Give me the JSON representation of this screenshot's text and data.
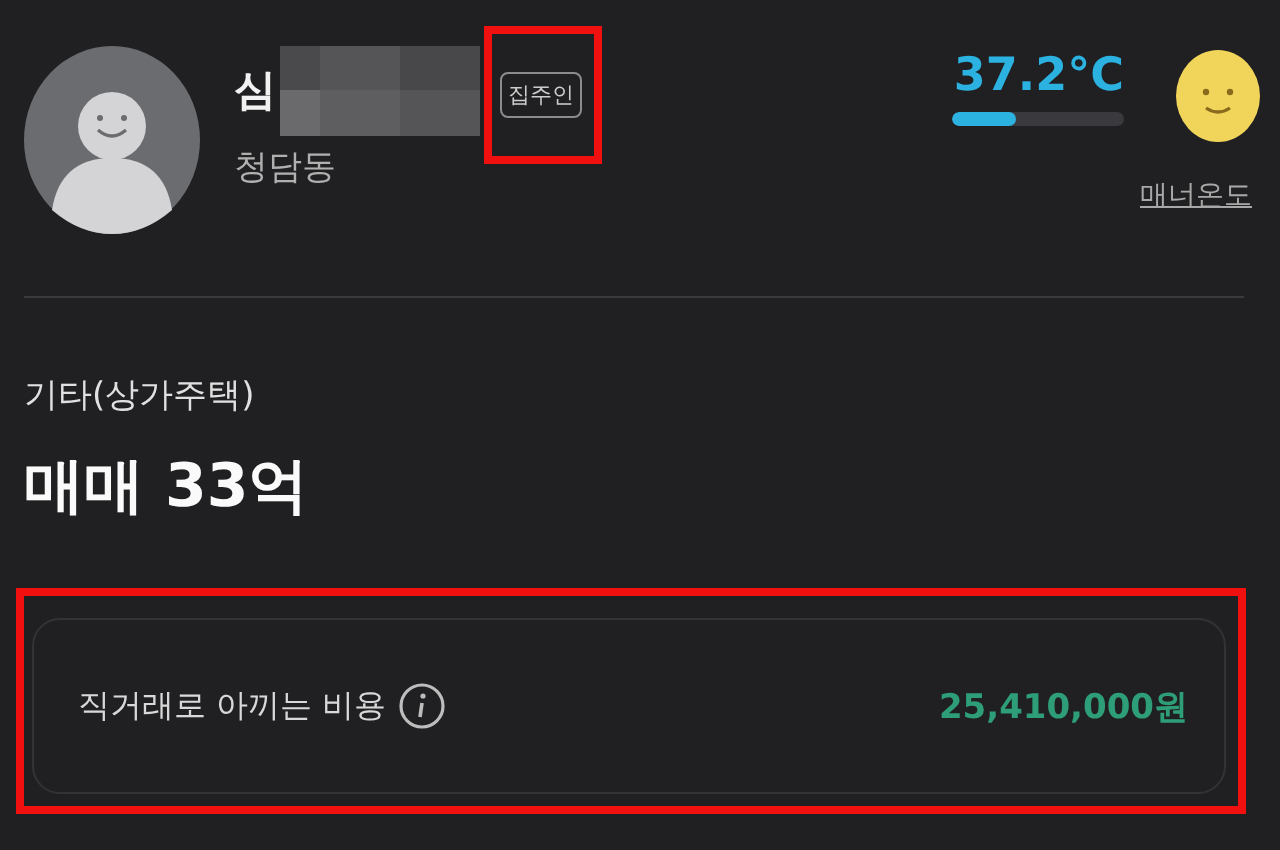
{
  "profile": {
    "name": "심",
    "badge": "집주인",
    "location": "청담동"
  },
  "manner": {
    "temperature": "37.2°C",
    "level": 0.37,
    "label": "매너온도"
  },
  "listing": {
    "category": "기타(상가주택)",
    "price": "매매 33억"
  },
  "savings": {
    "label": "직거래로 아끼는 비용",
    "amount": "25,410,000원"
  }
}
